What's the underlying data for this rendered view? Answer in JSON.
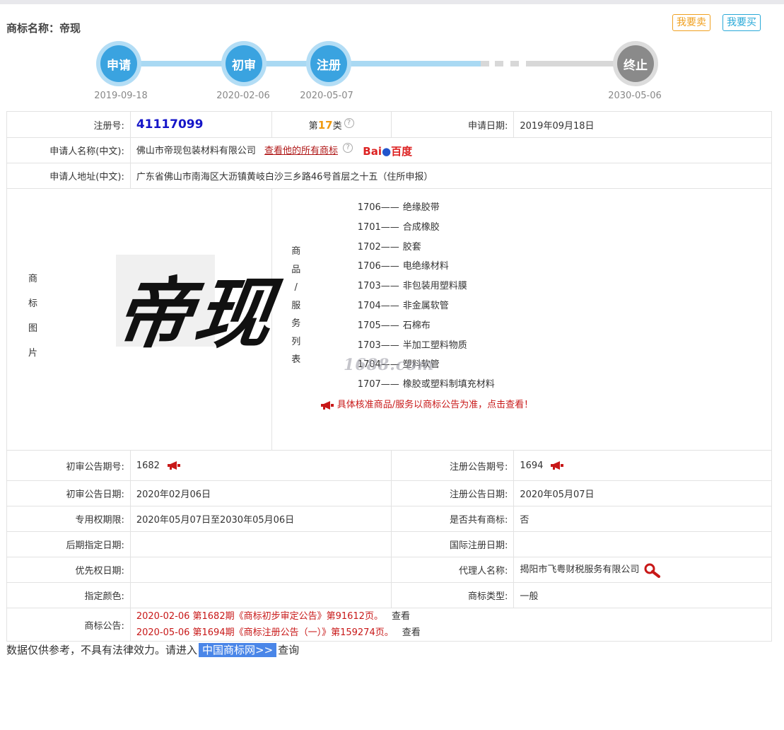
{
  "header": {
    "title": "商标名称：帝现",
    "sell_button": "我要卖",
    "buy_button": "我要买"
  },
  "timeline": [
    {
      "label": "申请",
      "date": "2019-09-18"
    },
    {
      "label": "初审",
      "date": "2020-02-06"
    },
    {
      "label": "注册",
      "date": "2020-05-07"
    },
    {
      "label": "终止",
      "date": "2030-05-06"
    }
  ],
  "info": {
    "reg_no_label": "注册号:",
    "reg_no": "41117099",
    "class_prefix": "第",
    "class_no": "17",
    "class_suffix": "类",
    "qmark": "?",
    "apply_date_label": "申请日期:",
    "apply_date": "2019年09月18日",
    "applicant_label": "申请人名称(中文):",
    "applicant": "佛山市帝现包装材料有限公司",
    "all_marks_link": "查看他的所有商标",
    "baidu_left": "Bai",
    "baidu_right": "百度",
    "address_label": "申请人地址(中文):",
    "address": "广东省佛山市南海区大沥镇黄岐白沙三乡路46号首层之十五（住所申报）",
    "image_label": [
      "商",
      "标",
      "图",
      "片"
    ],
    "mark_image_text": "帝现",
    "goods_label": [
      "商",
      "品",
      "/",
      "服",
      "务",
      "列",
      "表"
    ],
    "goods": [
      {
        "code": "1706——",
        "name": "绝缘胶带"
      },
      {
        "code": "1701——",
        "name": "合成橡胶"
      },
      {
        "code": "1702——",
        "name": "胶套"
      },
      {
        "code": "1706——",
        "name": "电绝缘材料"
      },
      {
        "code": "1703——",
        "name": "非包装用塑料膜"
      },
      {
        "code": "1704——",
        "name": "非金属软管"
      },
      {
        "code": "1705——",
        "name": "石棉布"
      },
      {
        "code": "1703——",
        "name": "半加工塑料物质"
      },
      {
        "code": "1704——",
        "name": "塑料软管"
      },
      {
        "code": "1707——",
        "name": "橡胶或塑料制填充材料"
      }
    ],
    "goods_notice": "具体核准商品/服务以商标公告为准，点击查看！",
    "watermark": "1688.com",
    "prelim_no_label": "初审公告期号:",
    "prelim_no": "1682",
    "reg_pub_no_label": "注册公告期号:",
    "reg_pub_no": "1694",
    "prelim_date_label": "初审公告日期:",
    "prelim_date": "2020年02月06日",
    "reg_pub_date_label": "注册公告日期:",
    "reg_pub_date": "2020年05月07日",
    "exclusive_label": "专用权期限:",
    "exclusive": "2020年05月07日至2030年05月06日",
    "shared_label": "是否共有商标:",
    "shared": "否",
    "later_date_label": "后期指定日期:",
    "later_date": "",
    "intl_date_label": "国际注册日期:",
    "intl_date": "",
    "priority_label": "优先权日期:",
    "priority": "",
    "agent_label": "代理人名称:",
    "agent": "揭阳市飞粤财税服务有限公司",
    "color_label": "指定颜色:",
    "color": "",
    "type_label": "商标类型:",
    "type": "一般",
    "gazette_label": "商标公告:",
    "gazettes": [
      {
        "text": "2020-02-06 第1682期《商标初步审定公告》第91612页。",
        "view": "查看"
      },
      {
        "text": "2020-05-06 第1694期《商标注册公告（一）》第159274页。",
        "view": "查看"
      }
    ]
  },
  "footer": {
    "prefix": "数据仅供参考，不具有法律效力。请进入",
    "link": "中国商标网>>",
    "suffix": "查询"
  },
  "colors": {
    "accent_blue": "#3aa3e0",
    "orange": "#f09a10",
    "red": "#c81818",
    "reg_no_blue": "#1515c8"
  }
}
